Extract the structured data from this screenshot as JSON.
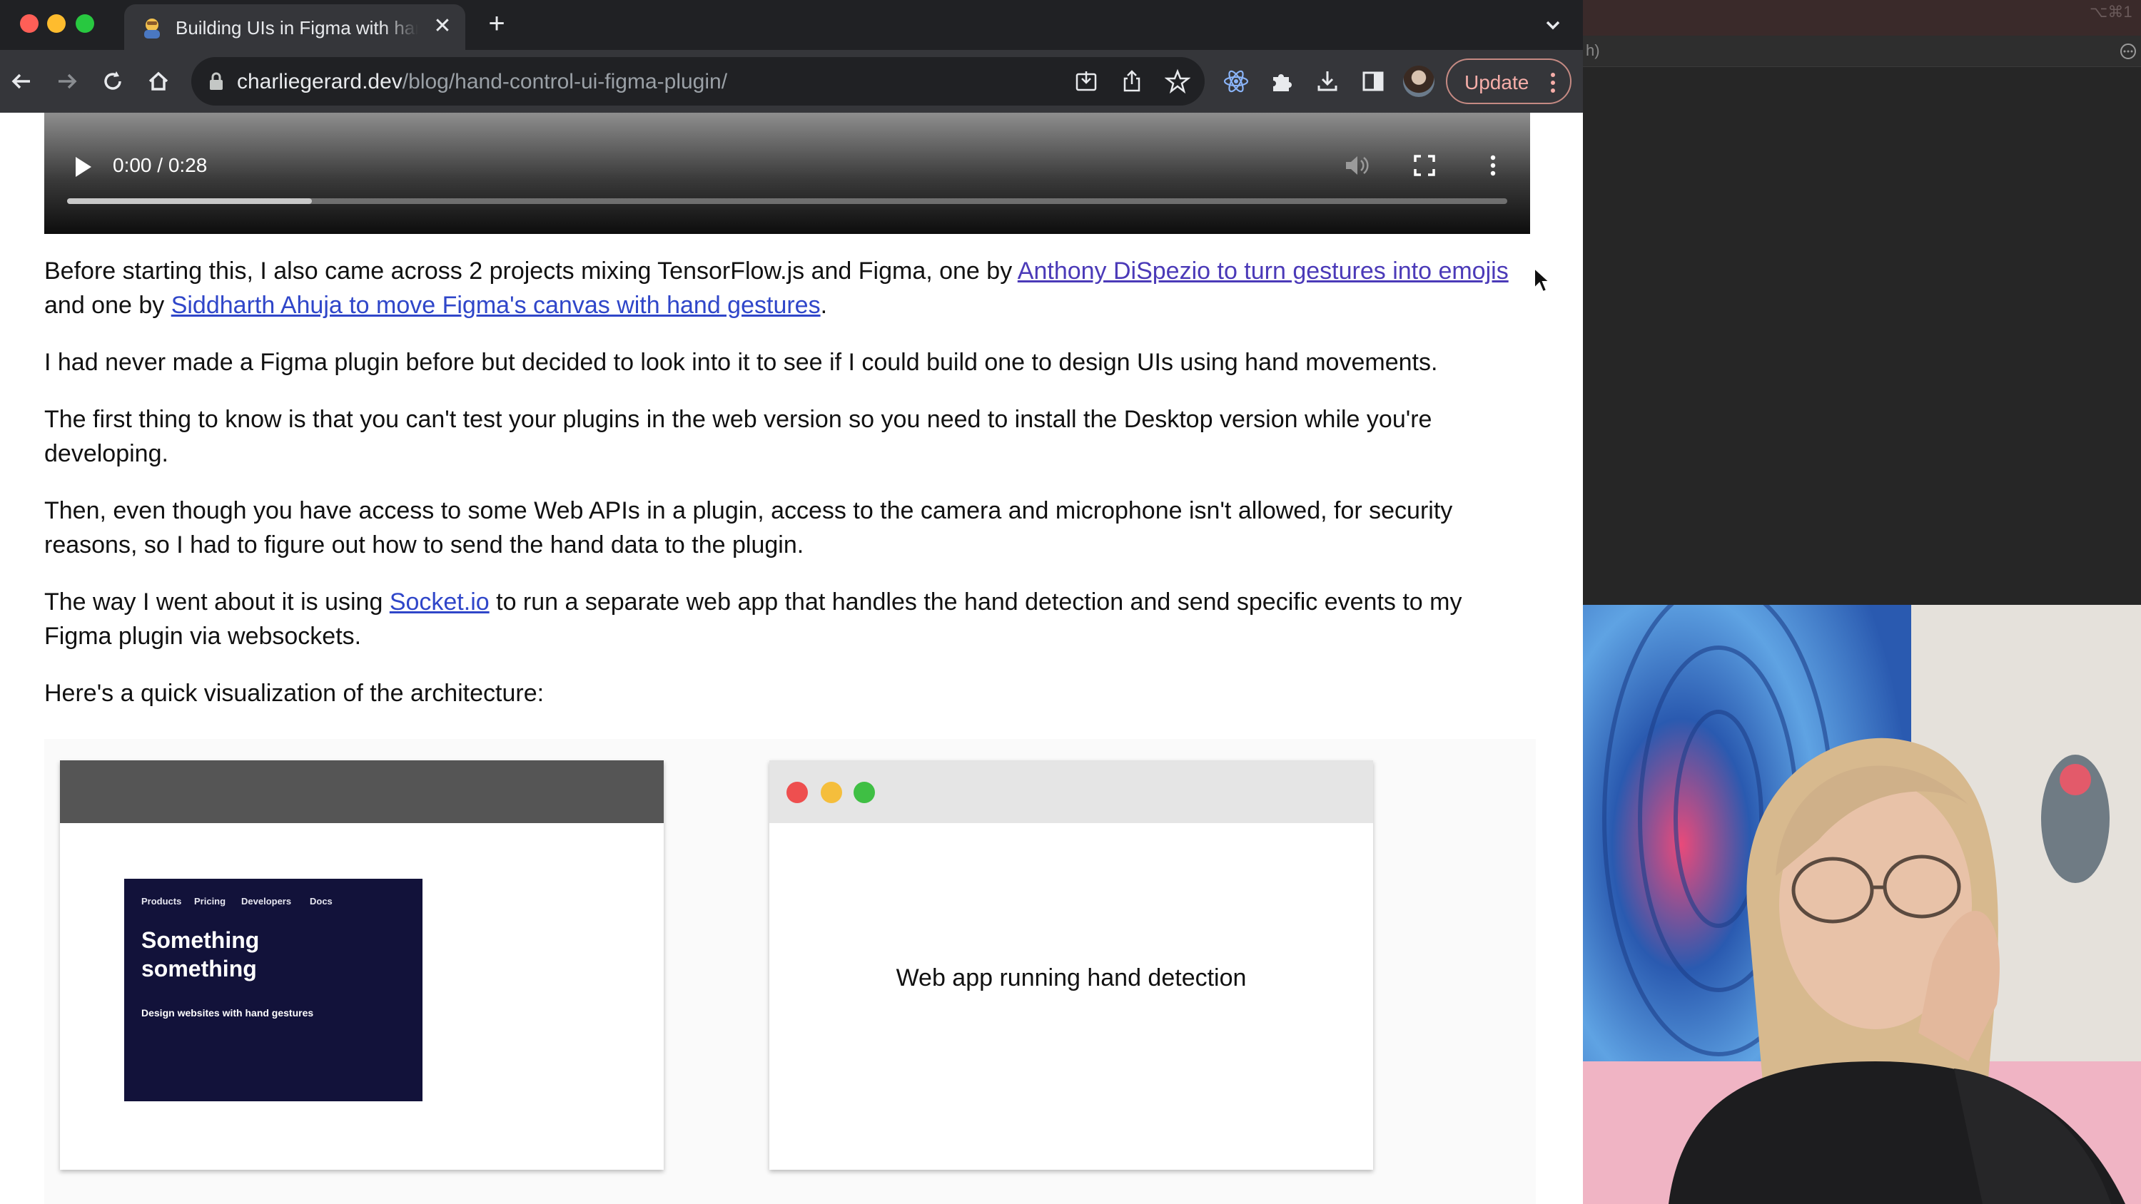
{
  "browser": {
    "tab": {
      "title": "Building UIs in Figma with hand movements",
      "close_glyph": "✕"
    },
    "new_tab_glyph": "+",
    "url": {
      "host": "charliegerard.dev",
      "path": "/blog/hand-control-ui-figma-plugin/"
    },
    "update_label": "Update"
  },
  "video": {
    "time": "0:00 / 0:28",
    "buffered_fraction": 0.17
  },
  "article": {
    "p1": {
      "before": "Before starting this, I also came across 2 projects mixing TensorFlow.js and Figma, one by ",
      "link1": "Anthony DiSpezio to turn gestures into emojis",
      "middle": " and one by ",
      "link2": "Siddharth Ahuja to move Figma's canvas with hand gestures",
      "after": "."
    },
    "p2": "I had never made a Figma plugin before but decided to look into it to see if I could build one to design UIs using hand movements.",
    "p3": "The first thing to know is that you can't test your plugins in the web version so you need to install the Desktop version while you're developing.",
    "p4": "Then, even though you have access to some Web APIs in a plugin, access to the camera and microphone isn't allowed, for security reasons, so I had to figure out how to send the hand data to the plugin.",
    "p5": {
      "before": "The way I went about it is using ",
      "link": "Socket.io",
      "after": " to run a separate web app that handles the hand detection and send specific events to my Figma plugin via websockets."
    },
    "p6": "Here's a quick visualization of the architecture:"
  },
  "diagram": {
    "mock_site": {
      "nav": [
        "Products",
        "Pricing",
        "Developers",
        "Docs"
      ],
      "heading": "Something something",
      "subheading": "Design websites with hand gestures"
    },
    "right_window_label": "Web app running hand detection",
    "dot_colors": [
      "#ee4f4f",
      "#f5be3c",
      "#3fbf44"
    ]
  },
  "side_panel": {
    "shortcut": "⌥⌘1",
    "search_fragment": "h)"
  }
}
